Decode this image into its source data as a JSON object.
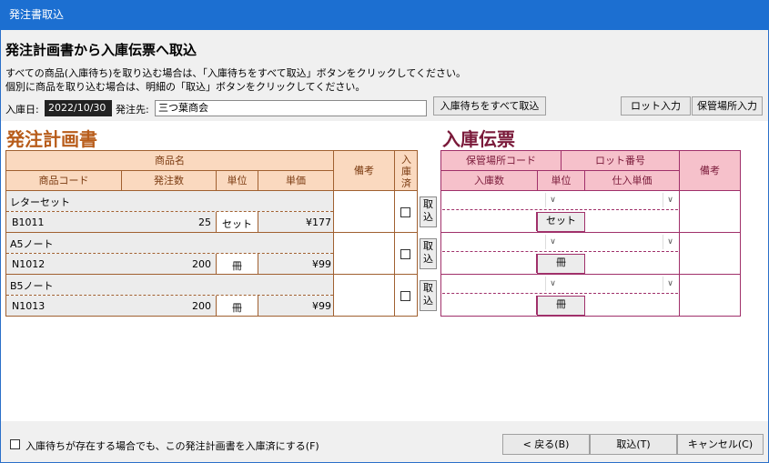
{
  "window": {
    "title": "発注書取込"
  },
  "header": {
    "heading": "発注計画書から入庫伝票へ取込",
    "instruction_1": "すべての商品(入庫待ち)を取り込む場合は、「入庫待ちをすべて取込」ボタンをクリックしてください。",
    "instruction_2": "個別に商品を取り込む場合は、明細の「取込」ボタンをクリックしてください。",
    "date_label": "入庫日:",
    "date_value": "2022/10/30",
    "supplier_label": "発注先:",
    "supplier_value": "三つ葉商会",
    "take_all_label": "入庫待ちをすべて取込",
    "lot_input_label": "ロット入力",
    "storage_input_label": "保管場所入力"
  },
  "po": {
    "title": "発注計画書",
    "headers": {
      "product_name": "商品名",
      "product_code": "商品コード",
      "order_qty": "発注数",
      "unit": "単位",
      "unit_price": "単価",
      "remarks": "備考",
      "received": "入庫済"
    },
    "rows": [
      {
        "name": "レターセット",
        "code": "B1011",
        "qty": "25",
        "unit": "セット",
        "price": "¥177"
      },
      {
        "name": "A5ノート",
        "code": "N1012",
        "qty": "200",
        "unit": "冊",
        "price": "¥99"
      },
      {
        "name": "B5ノート",
        "code": "N1013",
        "qty": "200",
        "unit": "冊",
        "price": "¥99"
      }
    ],
    "take_label_1": "取",
    "take_label_2": "込"
  },
  "slip": {
    "title": "入庫伝票",
    "headers": {
      "storage_code": "保管場所コード",
      "lot_no": "ロット番号",
      "receive_qty": "入庫数",
      "unit": "単位",
      "purchase_price": "仕入単価",
      "remarks": "備考"
    },
    "rows": [
      {
        "unit": "セット"
      },
      {
        "unit": "冊"
      },
      {
        "unit": "冊"
      }
    ]
  },
  "footer": {
    "mark_received_label": "入庫待ちが存在する場合でも、この発注計画書を入庫済にする(F)",
    "back_label": "< 戻る(B)",
    "import_label": "取込(T)",
    "cancel_label": "キャンセル(C)"
  },
  "colors": {
    "titlebar": "#1c6fd1",
    "po_header": "#fad9bf",
    "po_title": "#b85c1a",
    "slip_header": "#f6c1cb",
    "slip_title": "#7a1a3a"
  }
}
